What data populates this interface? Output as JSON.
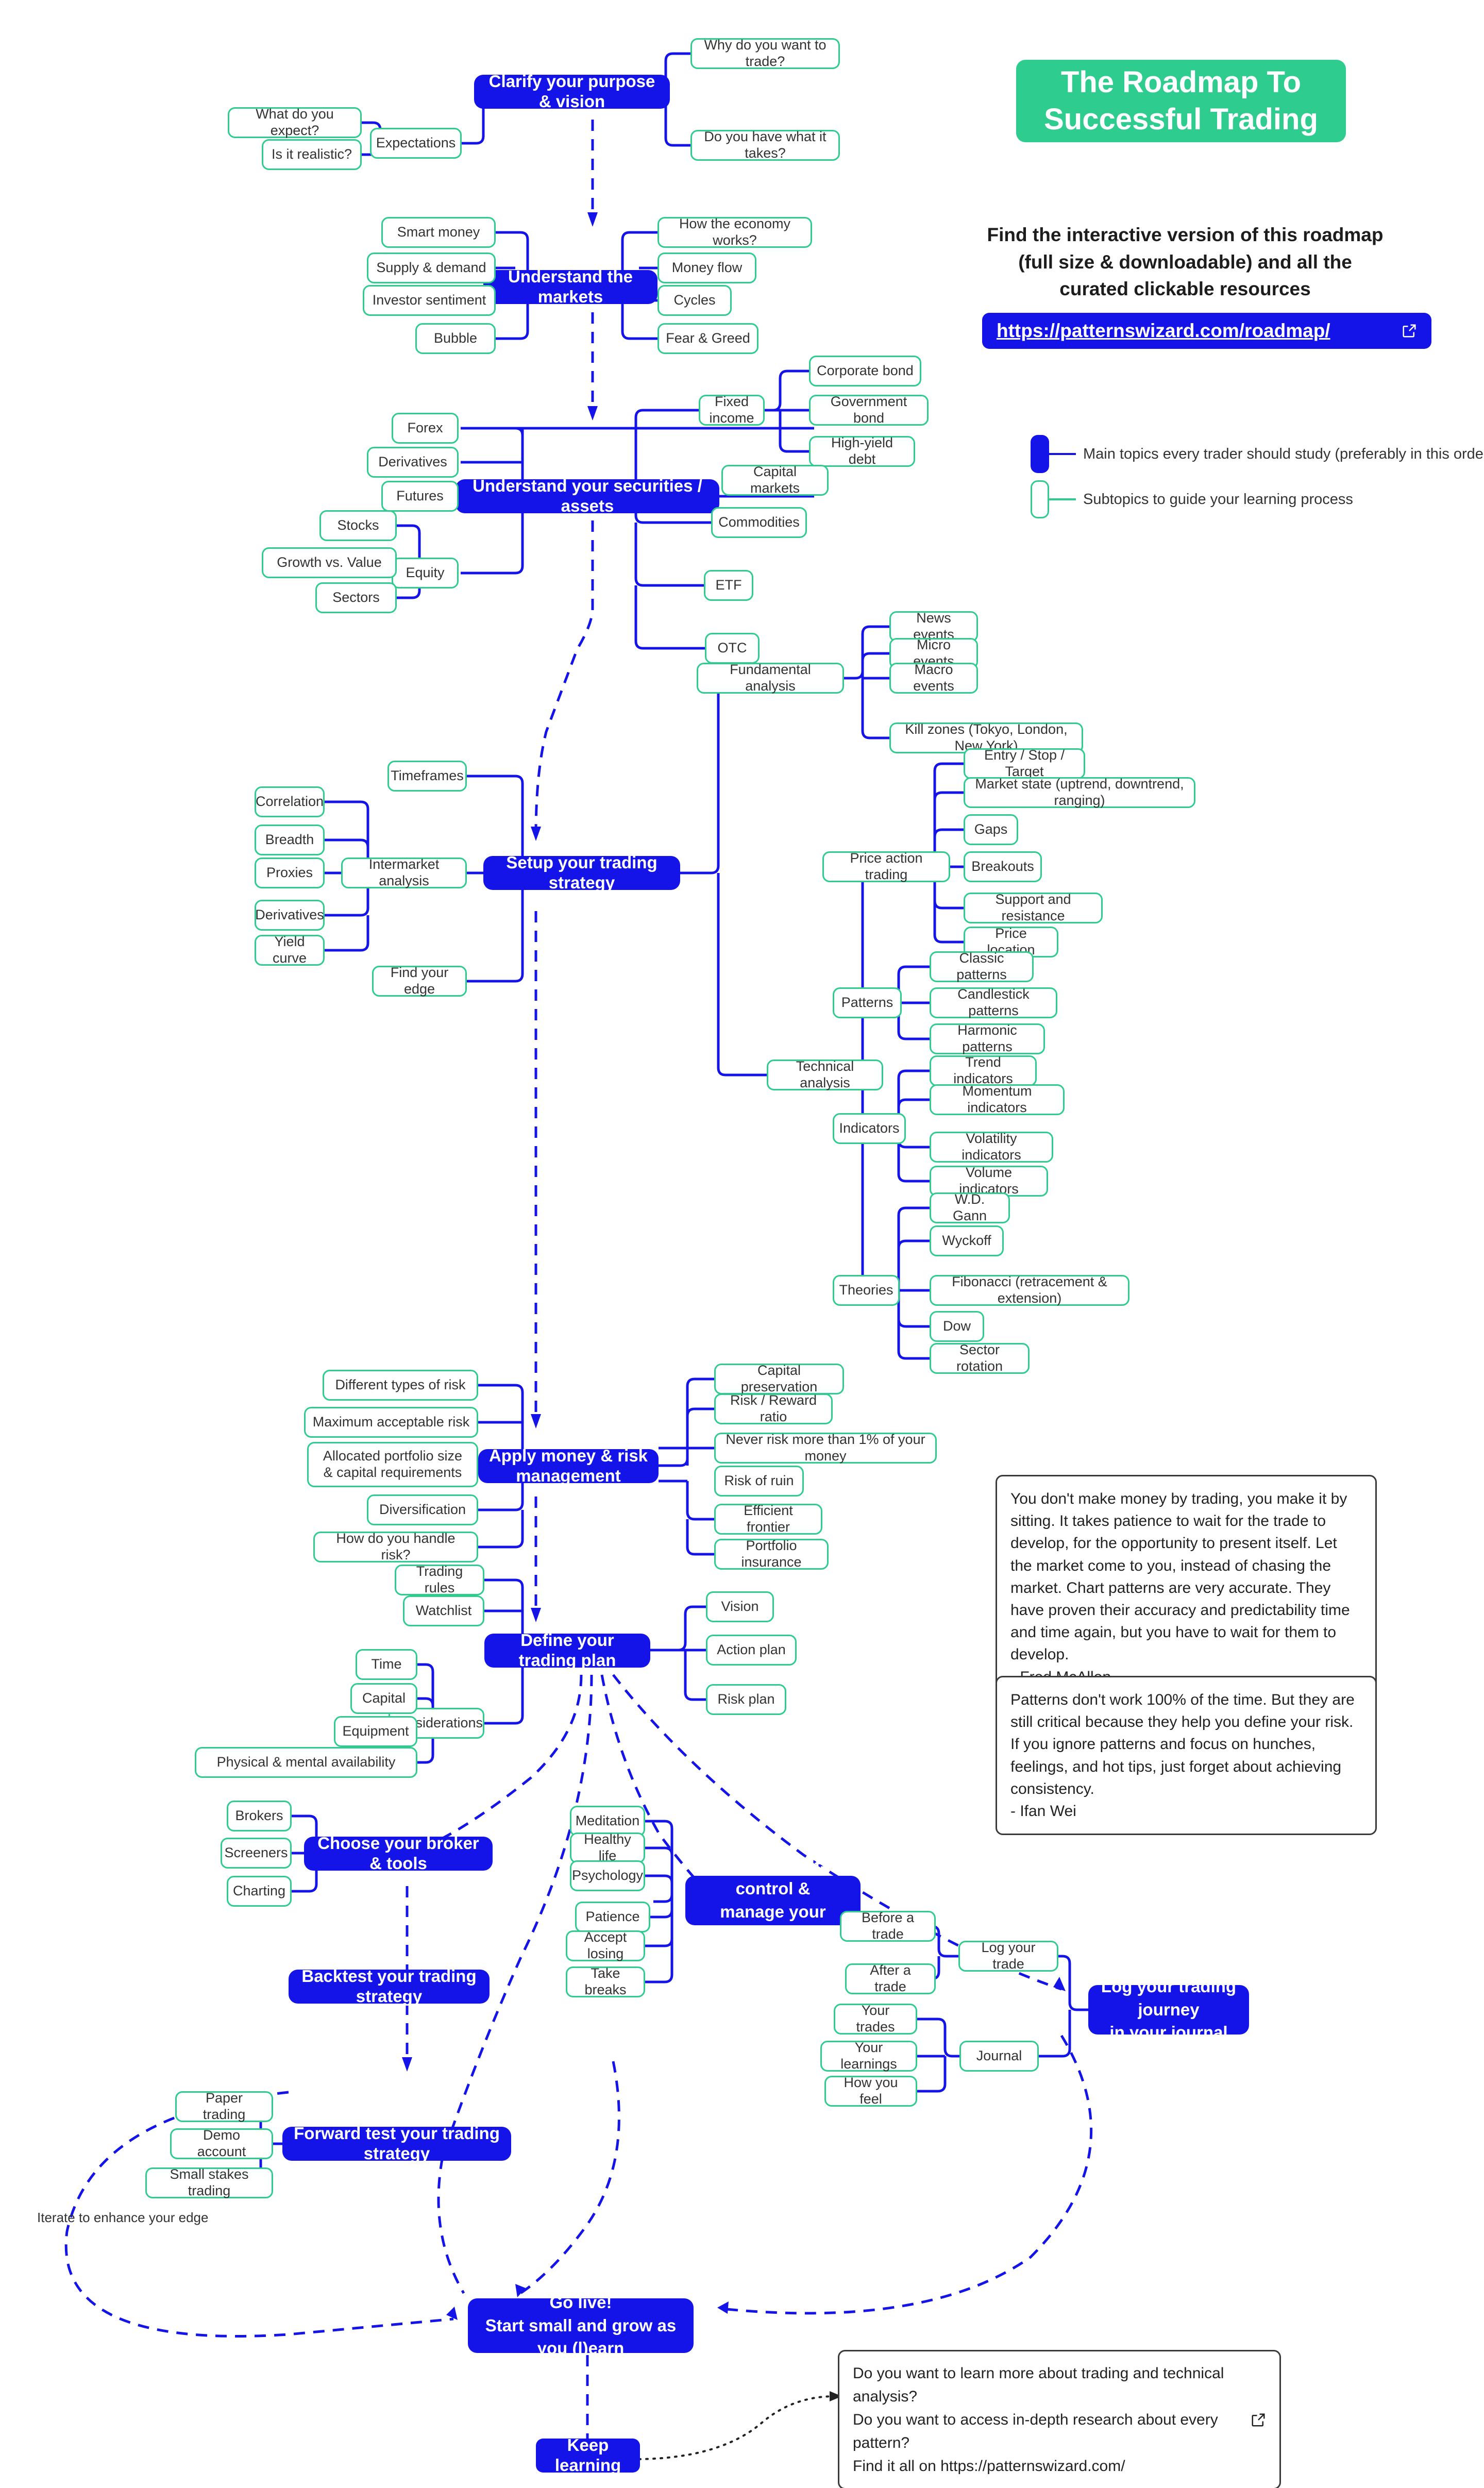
{
  "header": {
    "title": "The Roadmap To Successful Trading",
    "title_line1": "The Roadmap To",
    "title_line2": "Successful Trading",
    "promo": "Find the interactive version of this roadmap (full size & downloadable) and all the curated clickable resources",
    "url_label": "https://patternswizard.com/roadmap/",
    "external_link_icon": "external-link-icon"
  },
  "legend": {
    "main_label": "Main topics every trader should study (preferably in this order)",
    "sub_label": "Subtopics to guide your learning process",
    "main_color": "#1414e8",
    "sub_color": "#2ecc8f"
  },
  "nodes": {
    "m1": "Clarify your purpose & vision",
    "m1_a": "Why do you want to trade?",
    "m1_b": "Do you have what it takes?",
    "m1_c": "Expectations",
    "m1_c1": "What do you expect?",
    "m1_c2": "Is it realistic?",
    "m2": "Understand the markets",
    "m2_l1": "Smart money",
    "m2_l2": "Supply & demand",
    "m2_l3": "Investor sentiment",
    "m2_l4": "Bubble",
    "m2_r1": "How the economy works?",
    "m2_r2": "Money flow",
    "m2_r3": "Cycles",
    "m2_r4": "Fear & Greed",
    "m3": "Understand your securities / assets",
    "m3_l1": "Forex",
    "m3_l2": "Derivatives",
    "m3_l3": "Futures",
    "m3_l4": "Equity",
    "m3_l4a": "Stocks",
    "m3_l4b": "Growth vs. Value",
    "m3_l4c": "Sectors",
    "m3_r1": "Fixed income",
    "m3_r1a": "Corporate bond",
    "m3_r1b": "Government bond",
    "m3_r1c": "High-yield debt",
    "m3_r2": "Capital markets",
    "m3_r3": "Commodities",
    "m3_r4": "ETF",
    "m3_r5": "OTC",
    "m4": "Setup your trading strategy",
    "m4_l1": "Timeframes",
    "m4_l2": "Intermarket analysis",
    "m4_l2a": "Correlation",
    "m4_l2b": "Breadth",
    "m4_l2c": "Proxies",
    "m4_l2d": "Derivatives",
    "m4_l2e": "Yield curve",
    "m4_l3": "Find your edge",
    "m4_r1": "Fundamental analysis",
    "m4_r1a": "News events",
    "m4_r1b": "Micro events",
    "m4_r1c": "Macro events",
    "m4_r1d": "Kill zones (Tokyo, London, New York)",
    "m4_r2": "Technical analysis",
    "m4_r2a": "Price action trading",
    "m4_r2a1": "Entry / Stop / Target",
    "m4_r2a2": "Market state (uptrend, downtrend, ranging)",
    "m4_r2a3": "Gaps",
    "m4_r2a4": "Breakouts",
    "m4_r2a5": "Support and resistance",
    "m4_r2a6": "Price location",
    "m4_r2b": "Patterns",
    "m4_r2b1": "Classic patterns",
    "m4_r2b2": "Candlestick patterns",
    "m4_r2b3": "Harmonic patterns",
    "m4_r2c": "Indicators",
    "m4_r2c1": "Trend indicators",
    "m4_r2c2": "Momentum indicators",
    "m4_r2c3": "Volatility indicators",
    "m4_r2c4": "Volume indicators",
    "m4_r2d": "Theories",
    "m4_r2d1": "W.D. Gann",
    "m4_r2d2": "Wyckoff",
    "m4_r2d3": "Fibonacci (retracement & extension)",
    "m4_r2d4": "Dow",
    "m4_r2d5": "Sector rotation",
    "m5": "Apply money & risk management",
    "m5_l1": "Different types of risk",
    "m5_l2": "Maximum acceptable risk",
    "m5_l3": "Allocated portfolio size & capital requirements",
    "m5_l3_line1": "Allocated portfolio size",
    "m5_l3_line2": "& capital requirements",
    "m5_l4": "Diversification",
    "m5_l5": "How do you handle risk?",
    "m5_r1": "Capital preservation",
    "m5_r2": "Risk / Reward ratio",
    "m5_r3": "Never risk more than 1% of your money",
    "m5_r4": "Risk of ruin",
    "m5_r5": "Efficient frontier",
    "m5_r6": "Portfolio insurance",
    "m6": "Define your trading plan",
    "m6_l1": "Trading rules",
    "m6_l2": "Watchlist",
    "m6_l3": "Considerations",
    "m6_l3a": "Time",
    "m6_l3b": "Capital",
    "m6_l3c": "Equipment",
    "m6_l3d": "Physical & mental availability",
    "m6_r1": "Vision",
    "m6_r2": "Action plan",
    "m6_r3": "Risk plan",
    "m7": "Choose your broker & tools",
    "m7_l1": "Brokers",
    "m7_l2": "Screeners",
    "m7_l3": "Charting",
    "m8": "Practice self-control & manage your emotions",
    "m8_line1": "Practice self-control &",
    "m8_line2": "manage your emotions",
    "m8_l1": "Meditation",
    "m8_l2": "Healthy life",
    "m8_l3": "Psychology",
    "m8_l4": "Patience",
    "m8_l5": "Accept losing",
    "m8_l6": "Take breaks",
    "m9": "Backtest your trading strategy",
    "m10": "Log your trading journey in your journal",
    "m10_line1": "Log your trading journey",
    "m10_line2": "in your journal",
    "m10_l1": "Log your trade",
    "m10_l1a": "Before a trade",
    "m10_l1b": "After a trade",
    "m10_l2": "Journal",
    "m10_l2a": "Your trades",
    "m10_l2b": "Your learnings",
    "m10_l2c": "How you feel",
    "m11": "Forward test your trading strategy",
    "m11_l1": "Paper trading",
    "m11_l2": "Demo account",
    "m11_l3": "Small stakes trading",
    "m12": "Go live! Start small and grow as you (l)earn",
    "m12_line1": "Go live!",
    "m12_line2": "Start small and grow as you (l)earn",
    "m13": "Keep learning",
    "iterate_label": "Iterate to enhance your edge"
  },
  "quotes": [
    {
      "text": "You don't make money by trading, you make it by sitting. It takes patience to wait for the trade to develop, for the opportunity to present itself. Let the market come to you, instead of chasing the market. Chart patterns are very accurate. They have proven their accuracy and predictability time and time again, but you have to wait for them to develop.",
      "author": "- Fred McAllen"
    },
    {
      "text": "Patterns don't work 100% of the time. But they are still critical because they help you define your risk. If you ignore patterns and focus on hunches, feelings, and hot tips, just forget about achieving consistency.",
      "author": "- Ifan Wei"
    }
  ],
  "cta": {
    "line1": "Do you want to learn more about trading and technical analysis?",
    "line2": "Do you want to access in-depth research about every pattern?",
    "line3": "Find it all on https://patternswizard.com/",
    "icon": "external-link-icon"
  }
}
